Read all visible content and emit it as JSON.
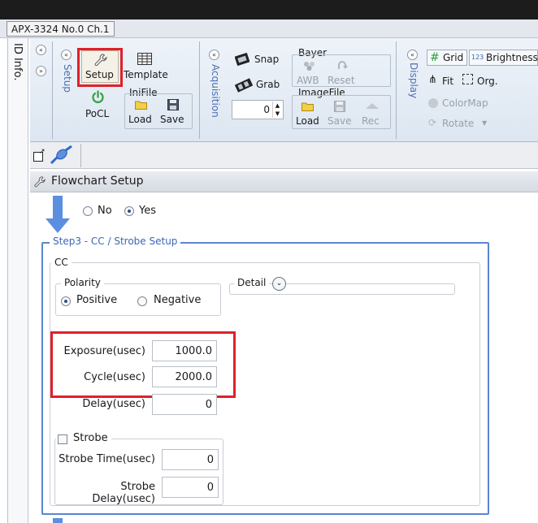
{
  "window": {
    "doc_tab": "APX-3324 No.0 Ch.1"
  },
  "info_pane": {
    "label": "ID Info."
  },
  "ribbon": {
    "groups": {
      "setup": "Setup",
      "acquisition": "Acquisition",
      "display": "Display"
    },
    "setup": {
      "setup_button": "Setup",
      "template_button": "Template",
      "pocl_button": "PoCL",
      "inifile_label": "IniFile",
      "inifile_load": "Load",
      "inifile_save": "Save"
    },
    "acquisition": {
      "snap_button": "Snap",
      "grab_button": "Grab",
      "frame_count": "0",
      "bayer_label": "Bayer",
      "awb_button": "AWB",
      "reset_button": "Reset",
      "imagefile_label": "ImageFile",
      "imagefile_load": "Load",
      "imagefile_save": "Save",
      "imagefile_rec": "Rec"
    },
    "display": {
      "grid_button": "Grid",
      "brightness_prefix": "123",
      "brightness_button": "Brightness",
      "fit_button": "Fit",
      "org_button": "Org.",
      "colormap_button": "ColorMap",
      "rotate_button": "Rotate"
    }
  },
  "panel": {
    "title": "Flowchart Setup",
    "no_label": "No",
    "yes_label": "Yes",
    "step_title": "Step3 - CC / Strobe Setup",
    "cc_label": "CC",
    "polarity_label": "Polarity",
    "positive_label": "Positive",
    "negative_label": "Negative",
    "detail_label": "Detail",
    "exposure_label": "Exposure(usec)",
    "exposure_value": "1000.0",
    "cycle_label": "Cycle(usec)",
    "cycle_value": "2000.0",
    "delay_label": "Delay(usec)",
    "delay_value": "0",
    "strobe_label": "Strobe",
    "strobe_time_label": "Strobe Time(usec)",
    "strobe_time_value": "0",
    "strobe_delay_label": "Strobe Delay(usec)",
    "strobe_delay_value": "0"
  },
  "colors": {
    "accent": "#4c6fb3",
    "highlight": "#e0202a",
    "arrow": "#5b8fe0",
    "pocl_green": "#2aa33a"
  }
}
